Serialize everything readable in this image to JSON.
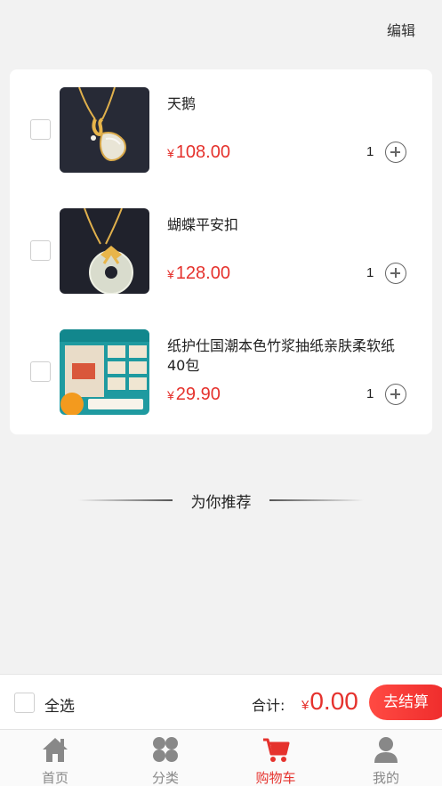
{
  "header": {
    "edit_label": "编辑"
  },
  "cart": {
    "items": [
      {
        "title": "天鹅",
        "currency": "¥",
        "price": "108.00",
        "quantity": "1",
        "image": "swan-pendant-necklace"
      },
      {
        "title": "蝴蝶平安扣",
        "currency": "¥",
        "price": "128.00",
        "quantity": "1",
        "image": "butterfly-jade-pendant"
      },
      {
        "title": "纸护仕国潮本色竹浆抽纸亲肤柔软纸40包",
        "currency": "¥",
        "price": "29.90",
        "quantity": "1",
        "image": "tissue-paper-pack"
      }
    ]
  },
  "recommend": {
    "title": "为你推荐"
  },
  "checkout": {
    "select_all_label": "全选",
    "total_label": "合计:",
    "currency": "¥",
    "total": "0.00",
    "button_label": "去结算"
  },
  "tabbar": {
    "tabs": [
      {
        "label": "首页",
        "icon": "home-icon",
        "active": false
      },
      {
        "label": "分类",
        "icon": "grid-icon",
        "active": false
      },
      {
        "label": "购物车",
        "icon": "cart-icon",
        "active": true
      },
      {
        "label": "我的",
        "icon": "user-icon",
        "active": false
      }
    ]
  },
  "colors": {
    "accent": "#e5322d",
    "background": "#f2f2f2",
    "inactive_tab": "#888888"
  }
}
